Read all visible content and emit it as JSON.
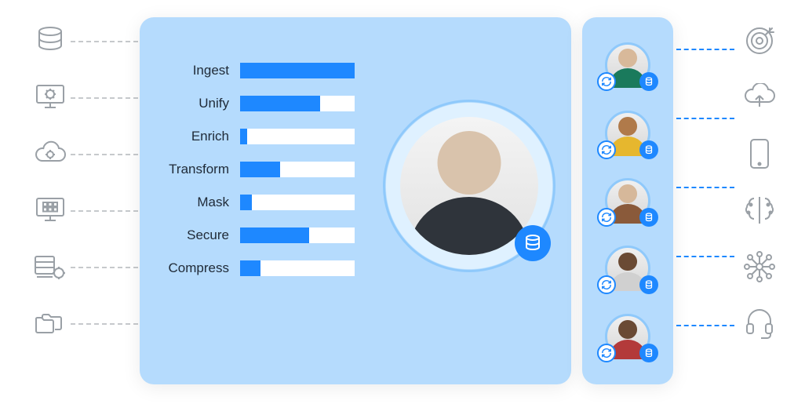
{
  "left_sources": [
    {
      "name": "database-stack-icon"
    },
    {
      "name": "computer-gear-icon"
    },
    {
      "name": "cloud-gear-icon"
    },
    {
      "name": "computer-grid-icon"
    },
    {
      "name": "server-gear-icon"
    },
    {
      "name": "folders-icon"
    }
  ],
  "main": {
    "metrics": [
      {
        "label": "Ingest",
        "value": 100
      },
      {
        "label": "Unify",
        "value": 70
      },
      {
        "label": "Enrich",
        "value": 6
      },
      {
        "label": "Transform",
        "value": 35
      },
      {
        "label": "Mask",
        "value": 10
      },
      {
        "label": "Secure",
        "value": 60
      },
      {
        "label": "Compress",
        "value": 18
      }
    ],
    "avatar_badge": "database-icon"
  },
  "people": [
    {
      "badges": {
        "left": "sync-icon",
        "right": "database-icon"
      }
    },
    {
      "badges": {
        "left": "sync-icon",
        "right": "database-icon"
      }
    },
    {
      "badges": {
        "left": "sync-icon",
        "right": "database-icon"
      }
    },
    {
      "badges": {
        "left": "sync-icon",
        "right": "database-icon"
      }
    },
    {
      "badges": {
        "left": "sync-icon",
        "right": "database-icon"
      }
    }
  ],
  "right_dests": [
    {
      "name": "target-icon"
    },
    {
      "name": "cloud-upload-icon"
    },
    {
      "name": "mobile-icon"
    },
    {
      "name": "brain-ai-icon"
    },
    {
      "name": "hub-network-icon"
    },
    {
      "name": "headset-icon"
    }
  ],
  "colors": {
    "panel_bg": "#b5dbfd",
    "accent": "#1e88ff",
    "bar_track": "#ffffff",
    "icon_gray": "#9aa0a6",
    "connector_gray": "#c6c9cc"
  },
  "chart_data": {
    "type": "bar",
    "categories": [
      "Ingest",
      "Unify",
      "Enrich",
      "Transform",
      "Mask",
      "Secure",
      "Compress"
    ],
    "values": [
      100,
      70,
      6,
      35,
      10,
      60,
      18
    ],
    "title": "",
    "xlabel": "",
    "ylabel": "",
    "ylim": [
      0,
      100
    ]
  }
}
